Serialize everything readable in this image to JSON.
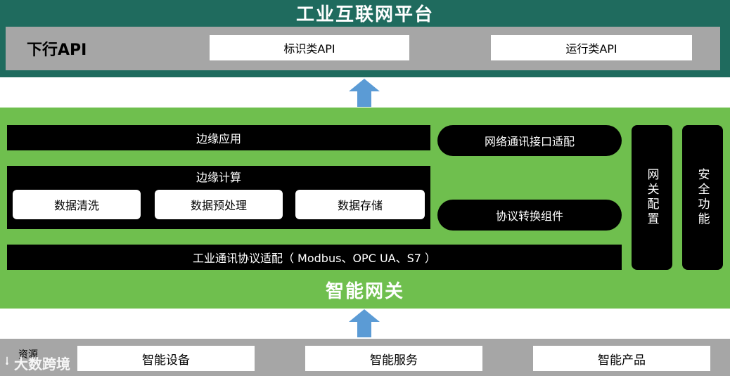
{
  "platform": {
    "title": "工业互联网平台",
    "downlink_label": "下行API",
    "apis": [
      "标识类API",
      "运行类API"
    ]
  },
  "gateway": {
    "title": "智能网关",
    "edge_app": "边缘应用",
    "edge_compute": {
      "label": "边缘计算",
      "items": [
        "数据清洗",
        "数据预处理",
        "数据存储"
      ]
    },
    "protocol_adapter": "工业通讯协议适配（ Modbus、OPC UA、S7 ）",
    "network_adapter": "网络通讯接口适配",
    "protocol_convert": "协议转换组件",
    "gateway_config": "网关配置",
    "security": "安全功能"
  },
  "resources": {
    "label": "资源",
    "items": [
      "智能设备",
      "智能服务",
      "智能产品"
    ]
  },
  "watermark": {
    "text": "大数跨境"
  },
  "colors": {
    "platform": "#1f6b5e",
    "gateway": "#6fbf4e",
    "bar_gray": "#a6a6a6",
    "arrow": "#5b9bd5",
    "block": "#000000"
  }
}
